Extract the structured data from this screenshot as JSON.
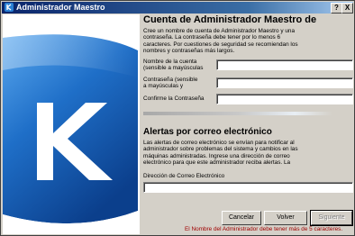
{
  "window": {
    "title": "Administrador Maestro",
    "help_label": "?",
    "close_label": "X"
  },
  "account": {
    "heading": "Cuenta de Administrador Maestro de",
    "description_lines": [
      "Cree un nombre de cuenta de Administrador Maestro y una",
      "contraseña. La contraseña debe tener por lo menos 6",
      "caracteres. Por cuestiones de seguridad se recomiendan los",
      "nombres y contraseñas más largos."
    ],
    "name_label_lines": [
      "Nombre de la cuenta",
      "(sensible a mayúsculas"
    ],
    "name_value": "",
    "password_label_lines": [
      "Contraseña (sensible",
      "a mayúsculas y"
    ],
    "password_value": "",
    "confirm_label": "Confirme la Contraseña",
    "confirm_value": ""
  },
  "alerts": {
    "heading": "Alertas por correo electrónico",
    "description_lines": [
      "Las alertas de correo electrónico se envían para notificar al",
      "administrador sobre problemas del sistema y cambios en las",
      "máquinas administradas. Ingrese una dirección de correo",
      "electrónico para que este administrador reciba alertas. La"
    ],
    "email_label": "Dirección de Correo Electrónico",
    "email_value": ""
  },
  "buttons": {
    "cancel": "Cancelar",
    "back": "Volver",
    "next": "Siguiente"
  },
  "status_message": "El Nombre del Administrador debe tener más de 5 caracteres.",
  "colors": {
    "title_bar": "#0a246a",
    "panel_blue": "#1f6fc8",
    "status_text": "#a00000"
  }
}
